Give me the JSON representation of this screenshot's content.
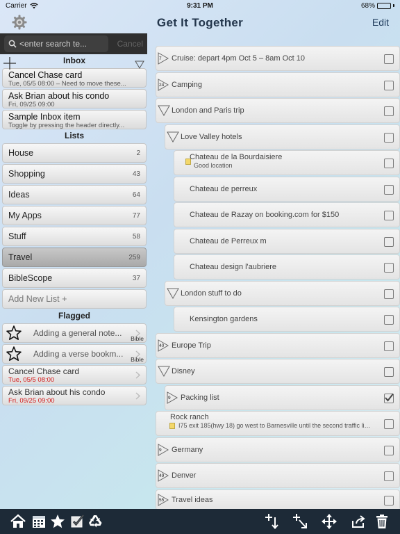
{
  "status": {
    "carrier": "Carrier",
    "time": "9:31 PM",
    "battery": "68%",
    "battery_level": 0.68
  },
  "nav": {
    "title": "Get It Together",
    "edit_label": "Edit"
  },
  "search": {
    "placeholder": "<enter search te...",
    "cancel_label": "Cancel"
  },
  "inbox": {
    "header": "Inbox",
    "items": [
      {
        "title": "Cancel Chase card",
        "subtitle": "Tue, 05/5 08:00 – Need to move these..."
      },
      {
        "title": "Ask Brian about his condo",
        "subtitle": "Fri, 09/25 09:00"
      },
      {
        "title": "Sample Inbox item",
        "subtitle": "Toggle by pressing the header directly..."
      }
    ]
  },
  "lists": {
    "header": "Lists",
    "items": [
      {
        "name": "House",
        "count": "2"
      },
      {
        "name": "Shopping",
        "count": "43"
      },
      {
        "name": "Ideas",
        "count": "64"
      },
      {
        "name": "My Apps",
        "count": "77"
      },
      {
        "name": "Stuff",
        "count": "58"
      },
      {
        "name": "Travel",
        "count": "259"
      },
      {
        "name": "BibleScope",
        "count": "37"
      }
    ],
    "add_label": "Add New List +"
  },
  "flagged": {
    "header": "Flagged",
    "notes": [
      {
        "text": "Adding a general note...",
        "tag": "Bible"
      },
      {
        "text": "Adding a verse bookm...",
        "tag": "Bible"
      }
    ],
    "tasks": [
      {
        "title": "Cancel Chase card",
        "date": "Tue, 05/5 08:00"
      },
      {
        "title": "Ask Brian about his condo",
        "date": "Fri, 09/25 09:00"
      }
    ]
  },
  "travel_rows": [
    {
      "label": "Cruise: depart 4pm Oct 5 – 8am Oct 10",
      "count": "7"
    },
    {
      "label": "Camping",
      "count": "24"
    },
    {
      "label": "London and Paris trip"
    },
    {
      "label": "Love Valley hotels"
    },
    {
      "label": "Chateau de la Bourdaisiere",
      "note": "Good location"
    },
    {
      "label": "Chateau de perreux"
    },
    {
      "label": "Chateau de Razay on booking.com for $150"
    },
    {
      "label": "Chateau de Perreux m"
    },
    {
      "label": "Chateau design l'aubriere"
    },
    {
      "label": "London stuff to do"
    },
    {
      "label": "Kensington gardens"
    },
    {
      "label": "Europe Trip",
      "count": "40"
    },
    {
      "label": "Disney"
    },
    {
      "label": "Packing list",
      "count": "9",
      "checked": true
    },
    {
      "label": "Rock ranch",
      "note": "I75 exit 185(hwy 18) go west to Barnesville until the second traffic lig..."
    },
    {
      "label": "Germany",
      "count": "9"
    },
    {
      "label": "Denver",
      "count": "49"
    },
    {
      "label": "Travel ideas",
      "count": "55"
    }
  ],
  "colors": {
    "toolbar": "#1d2a37",
    "title": "#23364c",
    "due_date": "#d41a1a",
    "search_bar": "#2f2f2f"
  }
}
